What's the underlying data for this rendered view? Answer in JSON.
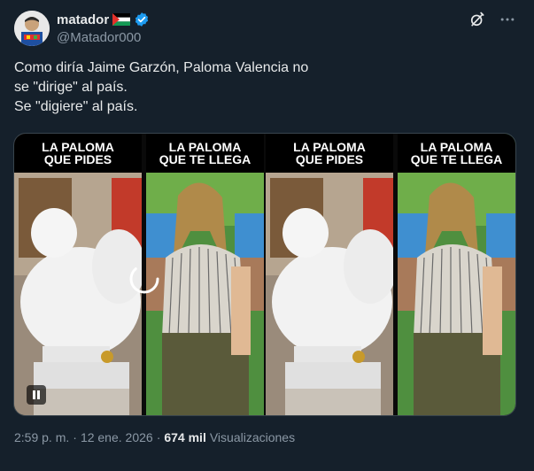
{
  "author": {
    "name": "matador",
    "handle": "@Matador000",
    "verified": true
  },
  "actions": {
    "grok_icon": "grok-icon",
    "more_icon": "more-icon"
  },
  "tweet": {
    "lines": [
      "Como diría Jaime Garzón, Paloma Valencia no",
      "se \"dirige\" al país.",
      "Se \"digiere\" al país."
    ]
  },
  "media": {
    "panels": [
      {
        "line1": "LA PALOMA",
        "line2": "QUE PIDES"
      },
      {
        "line1": "LA PALOMA",
        "line2": "QUE TE LLEGA"
      },
      {
        "line1": "LA PALOMA",
        "line2": "QUE PIDES"
      },
      {
        "line1": "LA PALOMA",
        "line2": "QUE TE LLEGA"
      }
    ]
  },
  "footer": {
    "time": "2:59 p. m.",
    "separator": "·",
    "date": "12 ene. 2026",
    "views_count": "674 mil",
    "views_label": "Visualizaciones"
  },
  "colors": {
    "background": "#15202b",
    "verified": "#1d9bf0",
    "secondary_text": "#8b98a5"
  }
}
